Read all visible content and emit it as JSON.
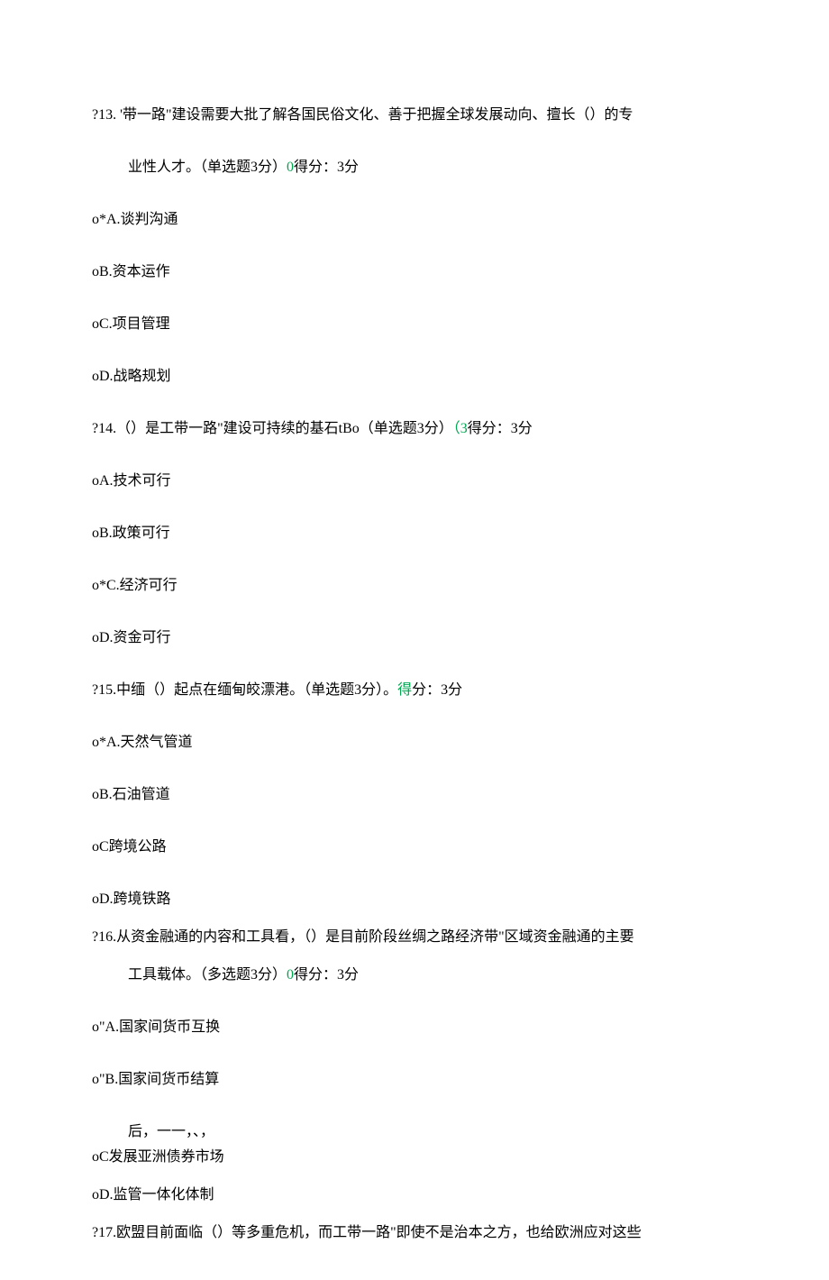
{
  "q13": {
    "line1_a": "?13.  '带一路\"建设需要大批了解各国民俗文化、善于把握全球发展动向、擅长（）的专",
    "line2_a": "业性人才。（单选题3分）",
    "line2_green": "0",
    "line2_b": "得分：3分",
    "optA": "o*A.谈判沟通",
    "optB": "oB.资本运作",
    "optC": "oC.项目管理",
    "optD": "oD.战略规划"
  },
  "q14": {
    "line1_a": "?14.（）是工带一路\"建设可持续的基石tBo（单选题3分）",
    "line1_green": "（3",
    "line1_b": "得分：3分",
    "optA": "oA.技术可行",
    "optB": "oB.政策可行",
    "optC": "o*C.经济可行",
    "optD": "oD.资金可行"
  },
  "q15": {
    "line1_a": "?15.中缅（）起点在缅甸皎漂港。（单选题3分）。",
    "line1_green": "得",
    "line1_b": "分：3分",
    "optA": "o*A.天然气管道",
    "optB": "oB.石油管道",
    "optC": "oC跨境公路",
    "optD": "oD.跨境铁路"
  },
  "q16": {
    "line1": "?16.从资金融通的内容和工具看，（）是目前阶段丝绸之路经济带\"区域资金融通的主要",
    "line2_a": "工具载体。（多选题3分）",
    "line2_green": "0",
    "line2_b": "得分：3分",
    "optA": "o\"A.国家间货币互换",
    "optB": "o\"B.国家间货币结算",
    "note": "后，一一，、，",
    "optC": "oC发展亚洲债券市场",
    "optD": "oD.监管一体化体制"
  },
  "q17": {
    "line1": "?17.欧盟目前面临（）等多重危机，而工带一路\"即使不是治本之方，也给欧洲应对这些"
  }
}
